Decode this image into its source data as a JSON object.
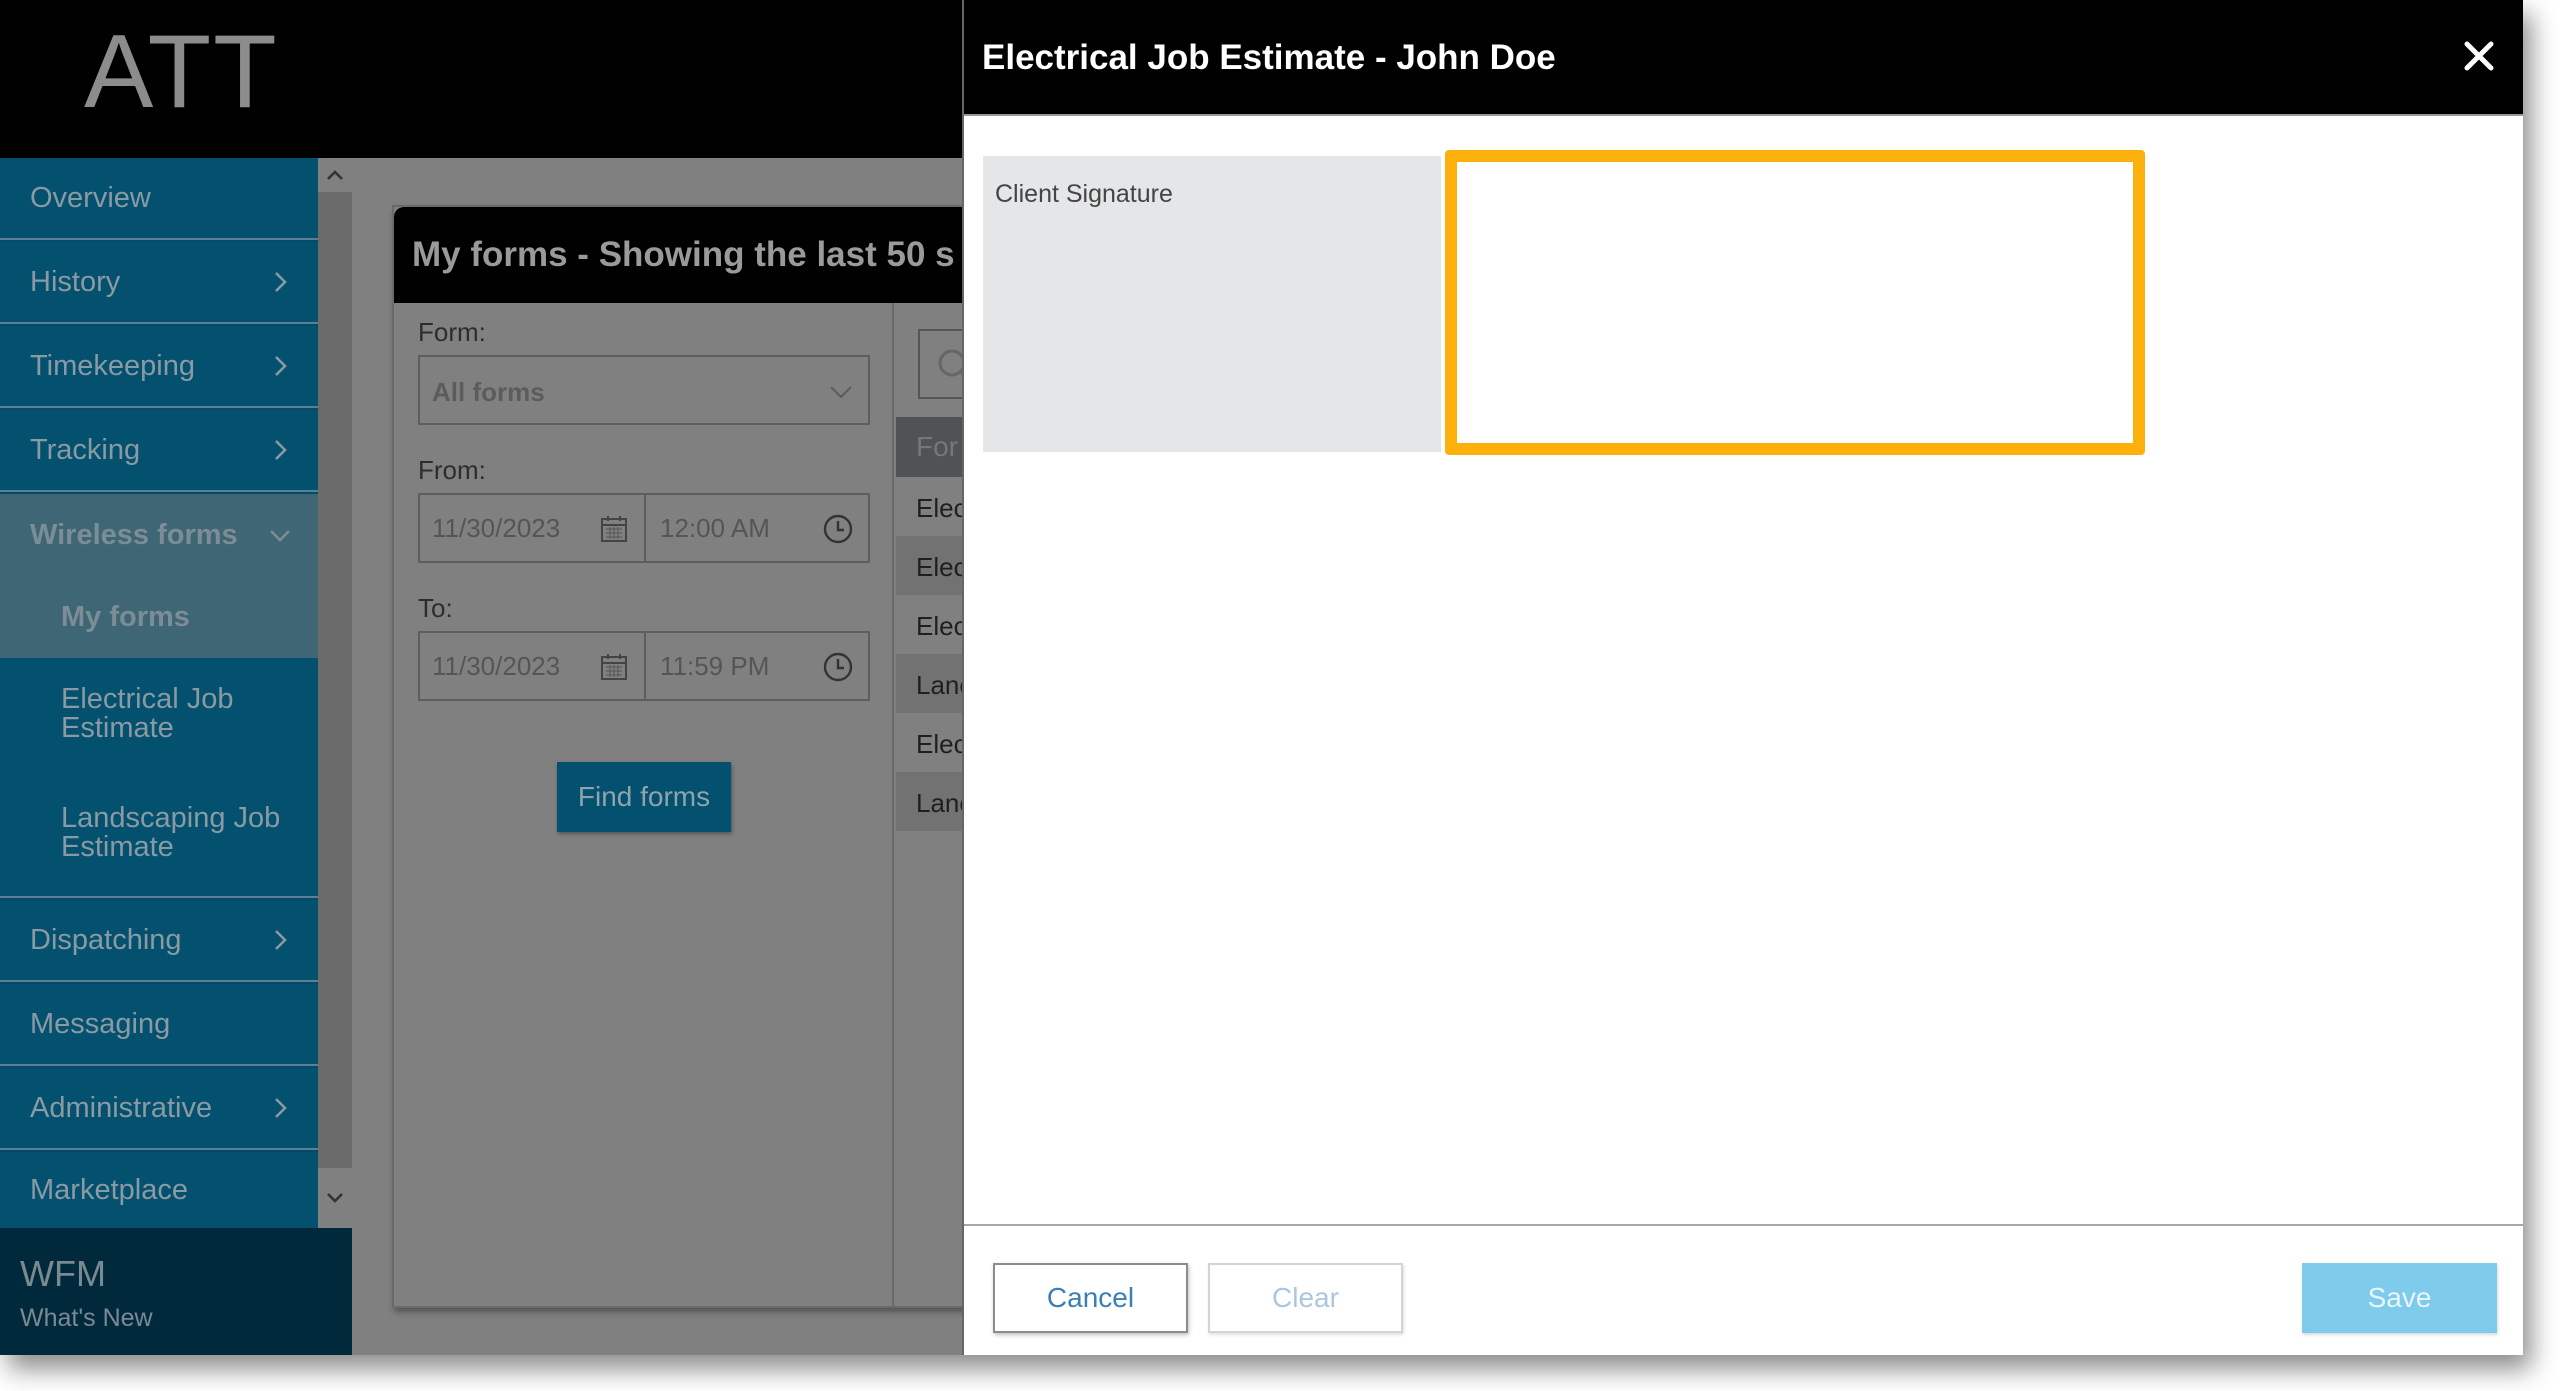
{
  "app": {
    "logo": "ATT",
    "footer_title": "WFM",
    "footer_link": "What's New"
  },
  "sidebar": {
    "items": [
      {
        "label": "Overview",
        "has_children": false
      },
      {
        "label": "History",
        "has_children": true
      },
      {
        "label": "Timekeeping",
        "has_children": true
      },
      {
        "label": "Tracking",
        "has_children": true
      },
      {
        "label": "Wireless forms",
        "has_children": true,
        "expanded": true
      },
      {
        "label": "My forms",
        "active": true
      },
      {
        "label": "Electrical Job Estimate"
      },
      {
        "label": "Landscaping Job Estimate"
      },
      {
        "label": "Dispatching",
        "has_children": true
      },
      {
        "label": "Messaging",
        "has_children": false
      },
      {
        "label": "Administrative",
        "has_children": true
      },
      {
        "label": "Marketplace",
        "has_children": false
      }
    ]
  },
  "forms_panel": {
    "title": "My forms - Showing the last 50 s",
    "form_label": "Form:",
    "form_value": "All forms",
    "from_label": "From:",
    "from_date": "11/30/2023",
    "from_time": "12:00 AM",
    "to_label": "To:",
    "to_date": "11/30/2023",
    "to_time": "11:59 PM",
    "find_button": "Find forms",
    "list_header": "For",
    "list_rows": [
      "Elec",
      "Elec",
      "Elec",
      "Lanc",
      "Elec",
      "Lanc"
    ]
  },
  "modal": {
    "title": "Electrical Job Estimate - John Doe",
    "signature_label": "Client Signature",
    "cancel_label": "Cancel",
    "clear_label": "Clear",
    "save_label": "Save",
    "accent_color": "#fcb00c"
  }
}
